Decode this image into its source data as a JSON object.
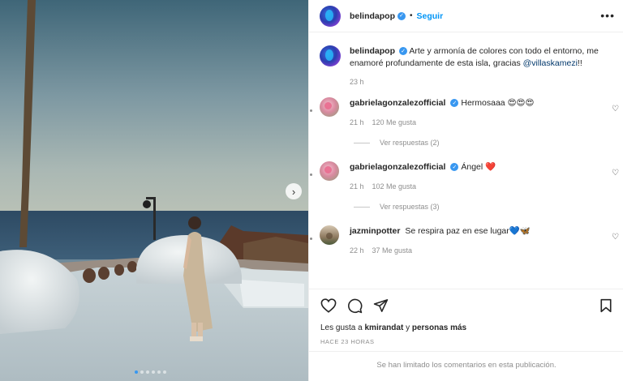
{
  "post": {
    "username": "belindapop",
    "separator": "•",
    "follow_label": "Seguir",
    "more_icon": "more-horizontal-icon",
    "caption_text": "Arte y armonía de colores con todo el entorno, me enamoré profundamente de esta isla, gracias",
    "caption_mention": "@villaskamezi",
    "caption_end": "!!",
    "caption_time": "23 h",
    "carousel_dots": 6,
    "carousel_active": 0
  },
  "comments": [
    {
      "username": "gabrielagonzalezofficial",
      "text": "Hermosaaa 😍😍😍",
      "time": "21 h",
      "likes": "120 Me gusta",
      "replies": "Ver respuestas (2)",
      "avatar": "pink"
    },
    {
      "username": "gabrielagonzalezofficial",
      "text": "Ángel ❤️",
      "time": "21 h",
      "likes": "102 Me gusta",
      "replies": "Ver respuestas (3)",
      "avatar": "pink"
    },
    {
      "username": "jazminpotter",
      "text": "Se respira paz en ese lugar💙🦋",
      "time": "22 h",
      "likes": "37 Me gusta",
      "replies": "",
      "avatar": "brown"
    }
  ],
  "actions": {
    "likes_prefix": "Les gusta a",
    "liked_by": "kmirandat",
    "likes_and": "y",
    "likes_others": "personas más",
    "posted": "HACE 23 HORAS",
    "comments_limited": "Se han limitado los comentarios en esta publicación."
  },
  "colors": {
    "accent": "#0095f6",
    "verified": "#3897f0",
    "muted": "#8e8e8e",
    "carousel_active_dot": "#3797f0"
  }
}
